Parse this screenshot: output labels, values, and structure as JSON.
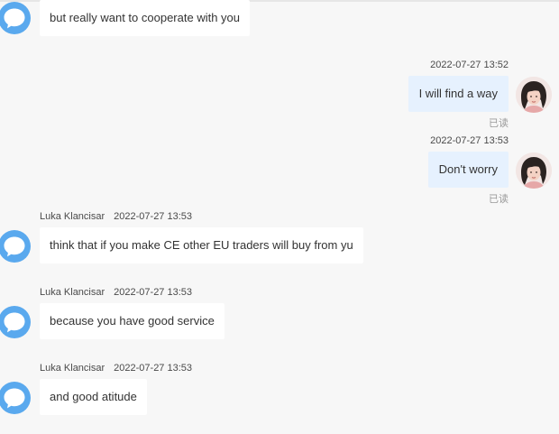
{
  "colors": {
    "page_background": "#f7f7f7",
    "incoming_bubble": "#ffffff",
    "outgoing_bubble": "#e6f1fe",
    "avatar_icon_blue": "#5aa9ee",
    "read_status": "#9a9a9a"
  },
  "messages": [
    {
      "direction": "in",
      "text": "but really want to cooperate with you",
      "avatar_icon": "chat-bubble-avatar-icon"
    },
    {
      "direction": "out",
      "timestamp": "2022-07-27 13:52",
      "text": "I will find a way",
      "status": "已读",
      "avatar_icon": "user-photo-avatar"
    },
    {
      "direction": "out",
      "timestamp": "2022-07-27 13:53",
      "text": "Don't worry",
      "status": "已读",
      "avatar_icon": "user-photo-avatar"
    },
    {
      "direction": "in",
      "sender": "Luka Klancisar",
      "timestamp": "2022-07-27 13:53",
      "text": "think that if you make CE other EU traders will buy from yu",
      "avatar_icon": "chat-bubble-avatar-icon"
    },
    {
      "direction": "in",
      "sender": "Luka Klancisar",
      "timestamp": "2022-07-27 13:53",
      "text": "because you have good service",
      "avatar_icon": "chat-bubble-avatar-icon"
    },
    {
      "direction": "in",
      "sender": "Luka Klancisar",
      "timestamp": "2022-07-27 13:53",
      "text": "and good atitude",
      "avatar_icon": "chat-bubble-avatar-icon"
    }
  ]
}
